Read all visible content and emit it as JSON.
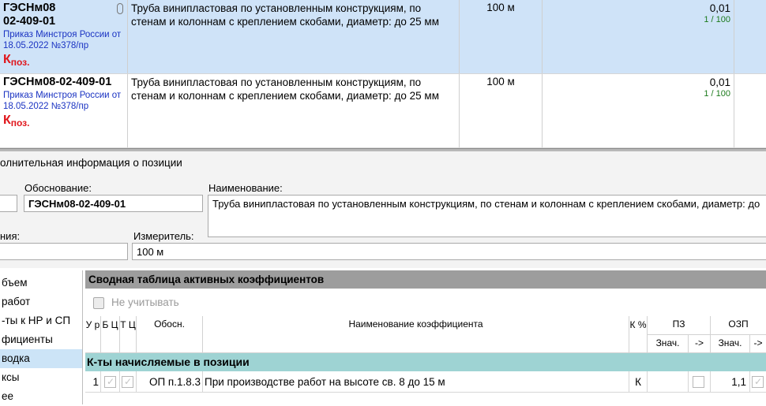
{
  "grid": {
    "rows": [
      {
        "code_line1": "ГЭСНм08",
        "code_line2": "02-409-01",
        "order": "Приказ Минстроя России от 18.05.2022 №378/пр",
        "kpos_main": "К",
        "kpos_sub": "поз.",
        "name": "Труба винипластовая по установленным конструкциям, по стенам и колоннам с креплением скобами, диаметр: до 25 мм",
        "unit": "100 м",
        "qty": "0,01",
        "ratio": "1 / 100"
      },
      {
        "code_line1": "ГЭСНм08-02-409-01",
        "order": "Приказ Минстроя России от 18.05.2022 №378/пр",
        "kpos_main": "К",
        "kpos_sub": "поз.",
        "name": "Труба винипластовая по установленным конструкциям, по стенам и колоннам с креплением скобами, диаметр: до 25 мм",
        "unit": "100 м",
        "qty": "0,01",
        "ratio": "1 / 100"
      }
    ]
  },
  "info": {
    "title": "олнительная информация о позиции",
    "basis_label": "Обоснование:",
    "basis_value": "ГЭСНм08-02-409-01",
    "name_label": "Наименование:",
    "name_value": "Труба винипластовая по установленным конструкциям, по стенам и колоннам с креплением скобами, диаметр: до",
    "left_label_partial": "ния:",
    "meter_label": "Измеритель:",
    "meter_value": "100 м"
  },
  "nav": {
    "items": [
      {
        "label": "бъем"
      },
      {
        "label": "работ"
      },
      {
        "label": "-ты к НР и СП"
      },
      {
        "label": "фициенты"
      },
      {
        "label": "водка"
      },
      {
        "label": "ксы"
      },
      {
        "label": "ее"
      }
    ],
    "active_index": 4
  },
  "coef": {
    "title": "Сводная таблица активных коэффициентов",
    "toolbar_ignore": "Не учитывать",
    "headers": {
      "ur": "У р",
      "bc": "Б Ц",
      "tc": "Т Ц",
      "basis": "Обосн.",
      "name": "Наименование коэффициента",
      "kpct": "К %",
      "pz": "ПЗ",
      "ozp": "ОЗП",
      "val": "Знач.",
      "arrow": "->"
    },
    "group": "К-ты начисляемые в позиции",
    "rows": [
      {
        "ur": "1",
        "basis": "ОП п.1.8.3",
        "name": "При производстве работ на высоте св. 8 до 15 м",
        "k": "К",
        "ozp_val": "1,1"
      }
    ]
  }
}
